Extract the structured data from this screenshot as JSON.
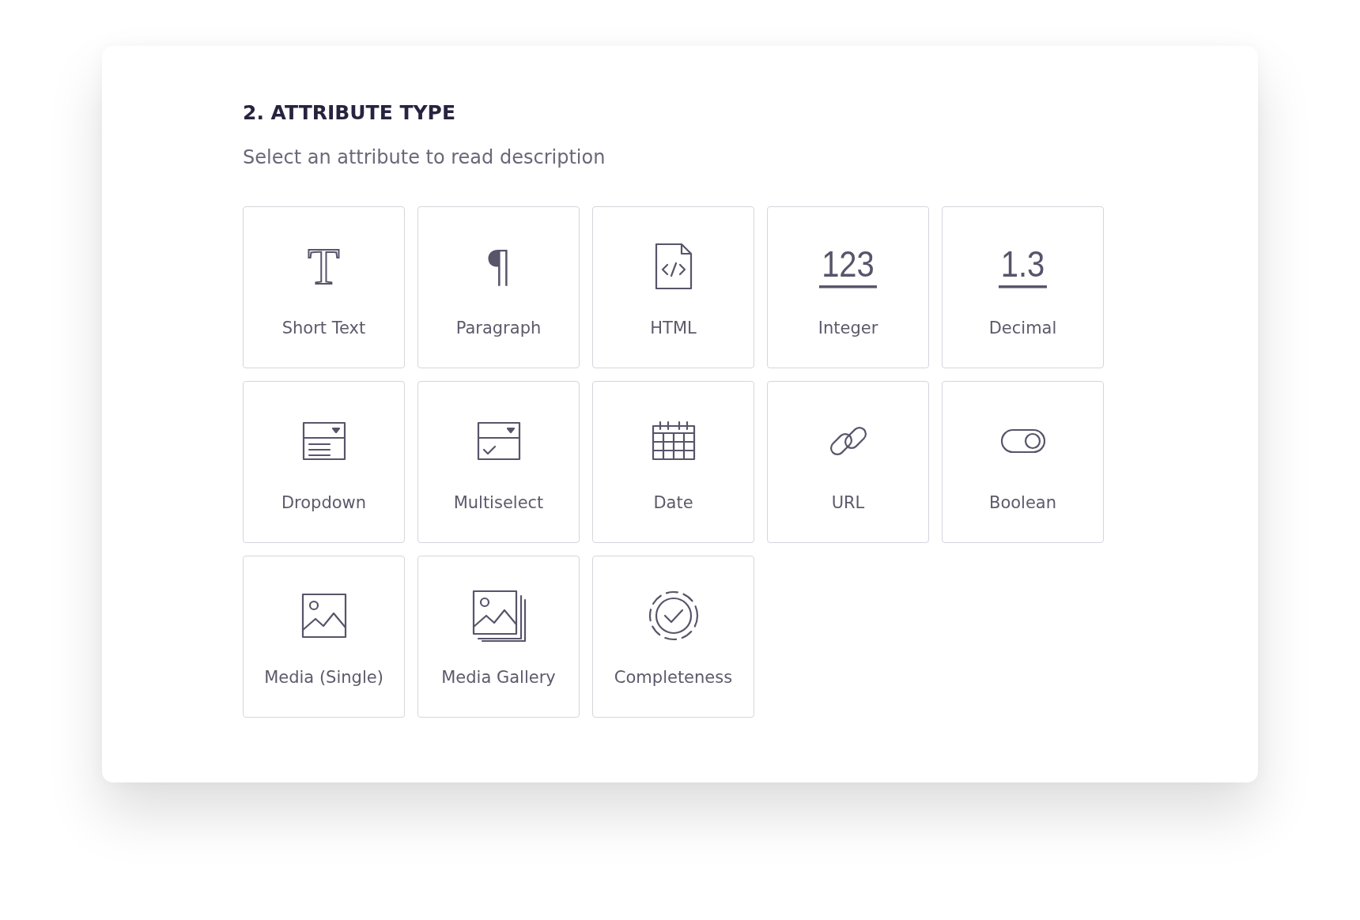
{
  "section": {
    "title": "2. ATTRIBUTE TYPE",
    "subtitle": "Select an attribute to read description"
  },
  "types": [
    {
      "kind": "text",
      "label": "Short Text",
      "glyph": "T"
    },
    {
      "kind": "paragraph",
      "label": "Paragraph",
      "glyph": "¶"
    },
    {
      "kind": "html",
      "label": "HTML"
    },
    {
      "kind": "number",
      "label": "Integer",
      "glyph": "123"
    },
    {
      "kind": "number",
      "label": "Decimal",
      "glyph": "1.3"
    },
    {
      "kind": "dropdown",
      "label": "Dropdown"
    },
    {
      "kind": "multiselect",
      "label": "Multiselect"
    },
    {
      "kind": "date",
      "label": "Date"
    },
    {
      "kind": "url",
      "label": "URL"
    },
    {
      "kind": "boolean",
      "label": "Boolean"
    },
    {
      "kind": "media",
      "label": "Media (Single)"
    },
    {
      "kind": "gallery",
      "label": "Media Gallery"
    },
    {
      "kind": "completeness",
      "label": "Completeness"
    }
  ]
}
